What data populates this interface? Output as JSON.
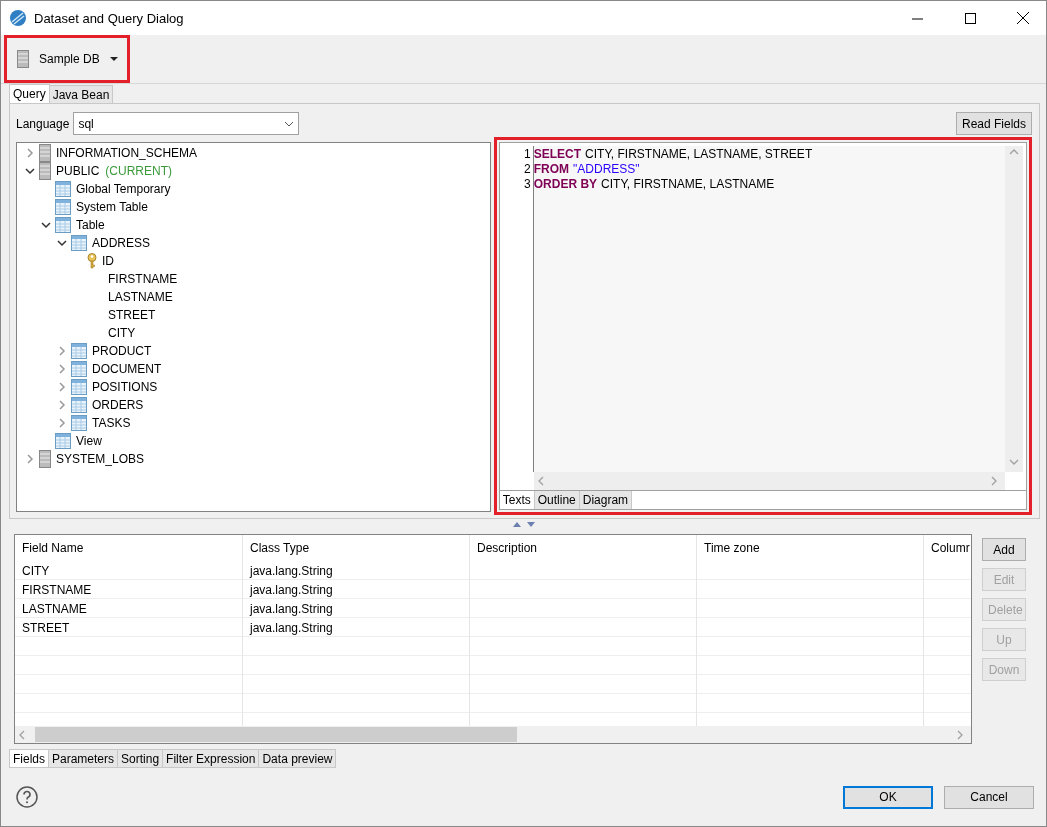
{
  "window": {
    "title": "Dataset and Query Dialog"
  },
  "data_source": {
    "label": "Sample DB",
    "highlighted": true
  },
  "query_tabs": [
    {
      "label": "Query",
      "selected": true
    },
    {
      "label": "Java Bean",
      "selected": false
    }
  ],
  "language": {
    "label": "Language",
    "value": "sql"
  },
  "read_fields_button": "Read Fields",
  "tree": [
    {
      "label": "INFORMATION_SCHEMA",
      "kind": "schema",
      "expanded": false
    },
    {
      "label": "PUBLIC",
      "note": "(CURRENT)",
      "kind": "schema",
      "expanded": true,
      "children": [
        {
          "label": "Global Temporary",
          "kind": "folder"
        },
        {
          "label": "System Table",
          "kind": "folder"
        },
        {
          "label": "Table",
          "kind": "folder",
          "expanded": true,
          "children": [
            {
              "label": "ADDRESS",
              "kind": "table",
              "expanded": true,
              "children": [
                {
                  "label": "ID",
                  "kind": "key"
                },
                {
                  "label": "FIRSTNAME",
                  "kind": "column"
                },
                {
                  "label": "LASTNAME",
                  "kind": "column"
                },
                {
                  "label": "STREET",
                  "kind": "column"
                },
                {
                  "label": "CITY",
                  "kind": "column"
                }
              ]
            },
            {
              "label": "PRODUCT",
              "kind": "table",
              "expanded": false
            },
            {
              "label": "DOCUMENT",
              "kind": "table",
              "expanded": false
            },
            {
              "label": "POSITIONS",
              "kind": "table",
              "expanded": false
            },
            {
              "label": "ORDERS",
              "kind": "table",
              "expanded": false
            },
            {
              "label": "TASKS",
              "kind": "table",
              "expanded": false
            }
          ]
        },
        {
          "label": "View",
          "kind": "folder"
        }
      ]
    },
    {
      "label": "SYSTEM_LOBS",
      "kind": "schema",
      "expanded": false
    }
  ],
  "editor": {
    "highlighted": true,
    "lines": [
      {
        "number": "1",
        "tokens": [
          {
            "text": "SELECT",
            "kind": "keyword"
          },
          {
            "text": "CITY, FIRSTNAME, LASTNAME, STREET",
            "kind": "plain"
          }
        ]
      },
      {
        "number": "2",
        "tokens": [
          {
            "text": "FROM",
            "kind": "keyword"
          },
          {
            "text": "\"ADDRESS\"",
            "kind": "string"
          }
        ]
      },
      {
        "number": "3",
        "tokens": [
          {
            "text": "ORDER BY",
            "kind": "keyword"
          },
          {
            "text": "CITY, FIRSTNAME, LASTNAME",
            "kind": "plain"
          }
        ]
      }
    ],
    "tabs": [
      {
        "label": "Texts",
        "selected": true
      },
      {
        "label": "Outline",
        "selected": false
      },
      {
        "label": "Diagram",
        "selected": false
      }
    ]
  },
  "table": {
    "columns": [
      "Field Name",
      "Class Type",
      "Description",
      "Time zone",
      "Columr"
    ],
    "rows": [
      [
        "CITY",
        "java.lang.String"
      ],
      [
        "FIRSTNAME",
        "java.lang.String"
      ],
      [
        "LASTNAME",
        "java.lang.String"
      ],
      [
        "STREET",
        "java.lang.String"
      ]
    ]
  },
  "table_buttons": [
    {
      "label": "Add",
      "disabled": false
    },
    {
      "label": "Edit",
      "disabled": true
    },
    {
      "label": "Delete",
      "disabled": true
    },
    {
      "label": "Up",
      "disabled": true
    },
    {
      "label": "Down",
      "disabled": true
    }
  ],
  "bottom_tabs": [
    {
      "label": "Fields",
      "selected": true
    },
    {
      "label": "Parameters",
      "selected": false
    },
    {
      "label": "Sorting",
      "selected": false
    },
    {
      "label": "Filter Expression",
      "selected": false
    },
    {
      "label": "Data preview",
      "selected": false
    }
  ],
  "footer_buttons": [
    {
      "label": "OK",
      "default": true
    },
    {
      "label": "Cancel",
      "default": false
    }
  ]
}
